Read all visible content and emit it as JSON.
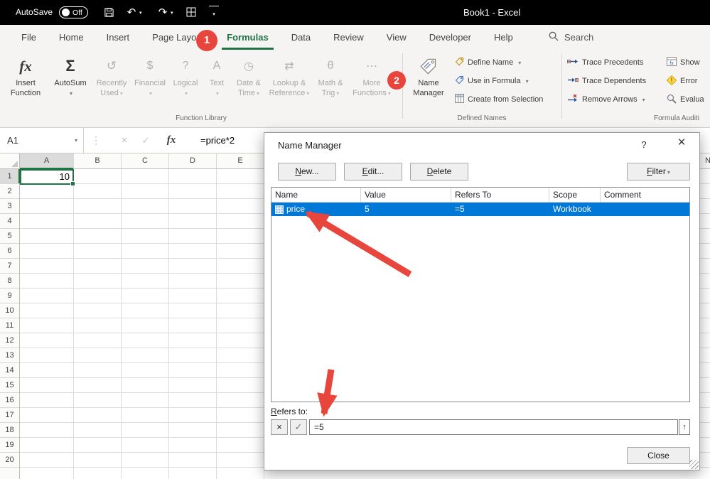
{
  "titlebar": {
    "autosave_label": "AutoSave",
    "autosave_state": "Off",
    "title": "Book1  -  Excel"
  },
  "tabs": [
    {
      "label": "File"
    },
    {
      "label": "Home"
    },
    {
      "label": "Insert"
    },
    {
      "label": "Page Layout"
    },
    {
      "label": "Formulas"
    },
    {
      "label": "Data"
    },
    {
      "label": "Review"
    },
    {
      "label": "View"
    },
    {
      "label": "Developer"
    },
    {
      "label": "Help"
    }
  ],
  "search": {
    "label": "Search"
  },
  "ribbon": {
    "insert_function": {
      "line1": "Insert",
      "line2": "Function"
    },
    "autosum": "AutoSum",
    "recently_used": {
      "line1": "Recently",
      "line2": "Used"
    },
    "financial": "Financial",
    "logical": "Logical",
    "text": "Text",
    "date_time": {
      "line1": "Date &",
      "line2": "Time"
    },
    "lookup": {
      "line1": "Lookup &",
      "line2": "Reference"
    },
    "math": {
      "line1": "Math &",
      "line2": "Trig"
    },
    "more_functions": {
      "line1": "More",
      "line2": "Functions"
    },
    "function_library_label": "Function Library",
    "name_manager": {
      "line1": "Name",
      "line2": "Manager"
    },
    "define_name": "Define Name",
    "use_in_formula": "Use in Formula",
    "create_from_selection": "Create from Selection",
    "defined_names_label": "Defined Names",
    "trace_precedents": "Trace Precedents",
    "trace_dependents": "Trace Dependents",
    "remove_arrows": "Remove Arrows",
    "show_formulas": "Show",
    "error_checking": "Error",
    "evaluate_formula": "Evalua",
    "formula_auditing_label": "Formula Auditi"
  },
  "formula_bar": {
    "name_box": "A1",
    "formula": "=price*2"
  },
  "grid": {
    "columns": [
      "A",
      "B",
      "C",
      "D",
      "E"
    ],
    "far_column": "N",
    "rows": [
      "1",
      "2",
      "3",
      "4",
      "5",
      "6",
      "7",
      "8",
      "9",
      "10",
      "11",
      "12",
      "13",
      "14",
      "15",
      "16",
      "17",
      "18",
      "19",
      "20"
    ],
    "a1_value": "10"
  },
  "dialog": {
    "title": "Name Manager",
    "help": "?",
    "close_x": "×",
    "new": "New...",
    "edit": "Edit...",
    "delete": "Delete",
    "filter": "Filter",
    "columns": [
      "Name",
      "Value",
      "Refers To",
      "Scope",
      "Comment"
    ],
    "row": {
      "name": "price",
      "value": "5",
      "refers_to": "=5",
      "scope": "Workbook",
      "comment": ""
    },
    "refers_label": "Refers to:",
    "refers_value": "=5",
    "up_arrow": "↑",
    "cancel_glyph": "×",
    "check_glyph": "✓",
    "close": "Close"
  },
  "annotations": {
    "step1": "1",
    "step2": "2"
  }
}
